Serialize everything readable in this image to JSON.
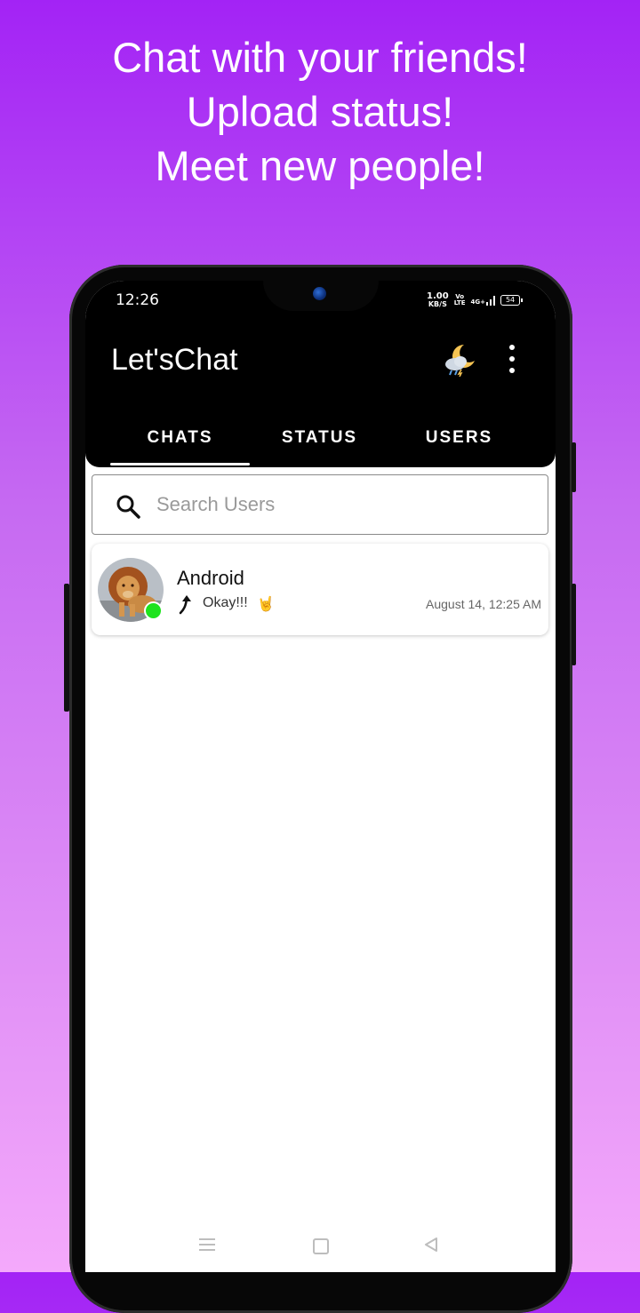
{
  "promo": {
    "line1": "Chat with your friends!",
    "line2": "Upload status!",
    "line3": "Meet new people!"
  },
  "status_bar": {
    "time": "12:26",
    "speed_value": "1.00",
    "speed_unit": "KB/S",
    "volte_top": "Vo",
    "volte_bottom": "LTE",
    "network": "4G+",
    "battery": "54"
  },
  "app_bar": {
    "title": "Let'sChat",
    "weather_icon": "weather-night-icon",
    "menu_icon": "more-vert-icon"
  },
  "tabs": [
    {
      "label": "CHATS",
      "active": true
    },
    {
      "label": "STATUS",
      "active": false
    },
    {
      "label": "USERS",
      "active": false
    }
  ],
  "search": {
    "placeholder": "Search Users",
    "value": ""
  },
  "chats": [
    {
      "name": "Android",
      "last_message": "Okay!!!",
      "emoji": "🤘",
      "timestamp": "August 14, 12:25 AM",
      "online": true,
      "online_color": "#1ee31e"
    }
  ],
  "colors": {
    "background_top": "#a323f5",
    "background_bottom": "#f4a9fb",
    "app_bar": "#000000"
  }
}
